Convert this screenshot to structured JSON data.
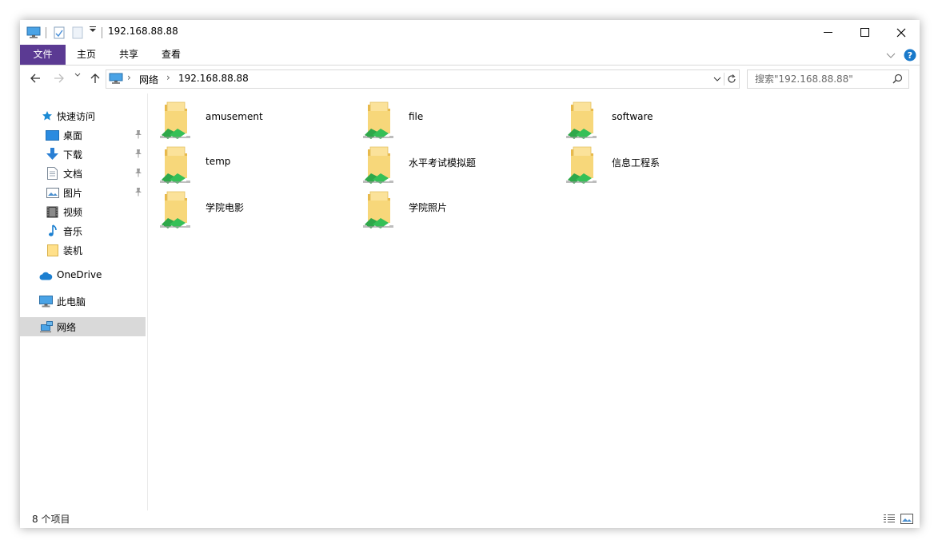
{
  "window": {
    "title": "192.168.88.88"
  },
  "ribbon": {
    "tabs": [
      {
        "label": "文件"
      },
      {
        "label": "主页"
      },
      {
        "label": "共享"
      },
      {
        "label": "查看"
      }
    ]
  },
  "address": {
    "breadcrumb": [
      "网络",
      "192.168.88.88"
    ]
  },
  "search": {
    "placeholder": "搜索\"192.168.88.88\""
  },
  "sidebar": {
    "quick_access": "快速访问",
    "pinned": [
      {
        "label": "桌面",
        "icon": "desktop-icon",
        "pinned": true
      },
      {
        "label": "下载",
        "icon": "download-icon",
        "pinned": true
      },
      {
        "label": "文档",
        "icon": "document-icon",
        "pinned": true
      },
      {
        "label": "图片",
        "icon": "picture-icon",
        "pinned": true
      },
      {
        "label": "视频",
        "icon": "video-icon",
        "pinned": false
      },
      {
        "label": "音乐",
        "icon": "music-icon",
        "pinned": false
      },
      {
        "label": "装机",
        "icon": "folder-icon",
        "pinned": false
      }
    ],
    "onedrive": "OneDrive",
    "this_pc": "此电脑",
    "network": "网络",
    "selected": "网络"
  },
  "folders": [
    {
      "name": "amusement",
      "icon": "shared-folder-icon"
    },
    {
      "name": "file",
      "icon": "shared-folder-icon"
    },
    {
      "name": "software",
      "icon": "shared-folder-icon"
    },
    {
      "name": "temp",
      "icon": "shared-folder-icon"
    },
    {
      "name": "水平考试模拟题",
      "icon": "shared-folder-icon"
    },
    {
      "name": "信息工程系",
      "icon": "shared-folder-icon"
    },
    {
      "name": "学院电影",
      "icon": "shared-folder-icon"
    },
    {
      "name": "学院照片",
      "icon": "shared-folder-icon"
    }
  ],
  "status": {
    "count": "8 个项目"
  },
  "colors": {
    "file_tab": "#5b3a93",
    "accent": "#1979ca",
    "selection": "#d9d9d9"
  }
}
